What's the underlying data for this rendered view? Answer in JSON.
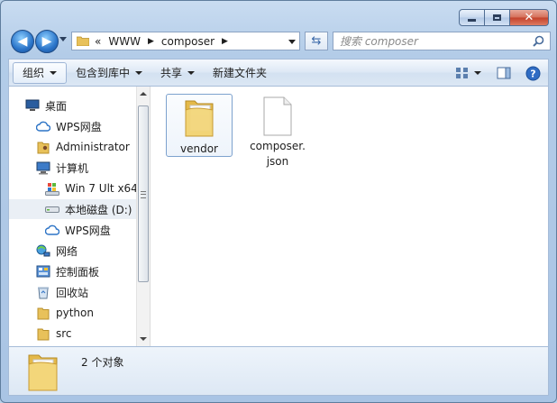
{
  "nav_path": [
    "WWW",
    "composer"
  ],
  "nav_path_prefix": "«",
  "search": {
    "placeholder": "搜索 composer"
  },
  "toolbar": {
    "organize": "组织",
    "include_in_library": "包含到库中",
    "share": "共享",
    "new_folder": "新建文件夹"
  },
  "sidebar": {
    "items": [
      {
        "label": "桌面",
        "icon": "desktop-icon"
      },
      {
        "label": "WPS网盘",
        "icon": "cloud-icon"
      },
      {
        "label": "Administrator",
        "icon": "user-folder-icon"
      },
      {
        "label": "计算机",
        "icon": "computer-icon"
      },
      {
        "label": "Win 7 Ult x64",
        "icon": "windows-drive-icon"
      },
      {
        "label": "本地磁盘 (D:)",
        "icon": "drive-icon",
        "selected": true
      },
      {
        "label": "WPS网盘",
        "icon": "cloud-icon"
      },
      {
        "label": "网络",
        "icon": "network-icon"
      },
      {
        "label": "控制面板",
        "icon": "control-panel-icon"
      },
      {
        "label": "回收站",
        "icon": "recycle-bin-icon"
      },
      {
        "label": "python",
        "icon": "folder-icon"
      },
      {
        "label": "src",
        "icon": "folder-icon"
      }
    ]
  },
  "files": [
    {
      "name": "vendor",
      "type": "folder",
      "selected": true
    },
    {
      "name_line1": "composer.",
      "name_line2": "json",
      "type": "file"
    }
  ],
  "status": {
    "count": "2 个对象"
  }
}
